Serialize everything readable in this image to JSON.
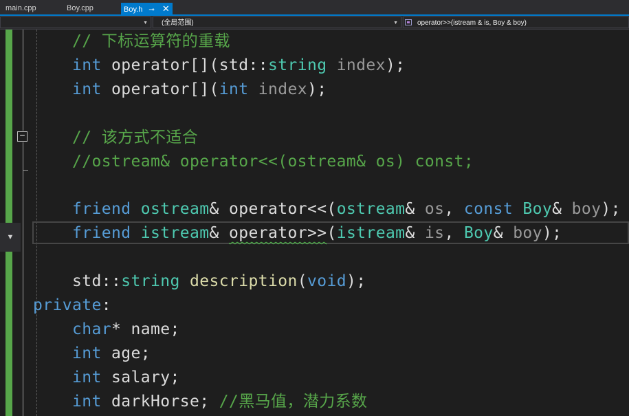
{
  "tabs": [
    {
      "label": "main.cpp",
      "active": false
    },
    {
      "label": "Boy.cpp",
      "active": false
    },
    {
      "label": "Boy.h",
      "active": true,
      "pin_icon": "pin-icon",
      "close_icon": "close-icon"
    }
  ],
  "navbar": {
    "project_combo": "",
    "scope_combo": "(全局范围)",
    "member_combo": "operator>>(istream & is, Boy & boy)",
    "member_icon": "method-icon"
  },
  "colors": {
    "keyword": "#569cd6",
    "type": "#4ec9b0",
    "comment": "#57a64a",
    "parameter": "#9a9a9a",
    "function": "#dcdcaa",
    "text": "#dcdcdc",
    "background": "#1e1e1e",
    "accent": "#007acc"
  },
  "editor": {
    "fold_icon": "collapse-minus-icon",
    "lines": [
      {
        "tokens": [
          {
            "t": "    "
          },
          {
            "t": "// 下标运算符的重载",
            "c": "cm"
          }
        ]
      },
      {
        "tokens": [
          {
            "t": "    "
          },
          {
            "t": "int",
            "c": "kw"
          },
          {
            "t": " operator[](std::"
          },
          {
            "t": "string",
            "c": "ty"
          },
          {
            "t": " "
          },
          {
            "t": "index",
            "c": "pm"
          },
          {
            "t": ");"
          }
        ]
      },
      {
        "tokens": [
          {
            "t": "    "
          },
          {
            "t": "int",
            "c": "kw"
          },
          {
            "t": " operator[]("
          },
          {
            "t": "int",
            "c": "kw"
          },
          {
            "t": " "
          },
          {
            "t": "index",
            "c": "pm"
          },
          {
            "t": ");"
          }
        ]
      },
      {
        "tokens": []
      },
      {
        "tokens": [
          {
            "t": "    "
          },
          {
            "t": "// 该方式不适合",
            "c": "cm"
          }
        ]
      },
      {
        "tokens": [
          {
            "t": "    "
          },
          {
            "t": "//ostream& operator<<(ostream& os) const;",
            "c": "cm"
          }
        ]
      },
      {
        "tokens": []
      },
      {
        "tokens": [
          {
            "t": "    "
          },
          {
            "t": "friend",
            "c": "kw"
          },
          {
            "t": " "
          },
          {
            "t": "ostream",
            "c": "ty"
          },
          {
            "t": "& operator<<("
          },
          {
            "t": "ostream",
            "c": "ty"
          },
          {
            "t": "& "
          },
          {
            "t": "os",
            "c": "pm"
          },
          {
            "t": ", "
          },
          {
            "t": "const",
            "c": "kw"
          },
          {
            "t": " "
          },
          {
            "t": "Boy",
            "c": "ty"
          },
          {
            "t": "& "
          },
          {
            "t": "boy",
            "c": "pm"
          },
          {
            "t": ");"
          }
        ]
      },
      {
        "tokens": [
          {
            "t": "    "
          },
          {
            "t": "friend",
            "c": "kw"
          },
          {
            "t": " "
          },
          {
            "t": "istream",
            "c": "ty"
          },
          {
            "t": "& "
          },
          {
            "t": "operator>>",
            "c": "squiggle"
          },
          {
            "t": "("
          },
          {
            "t": "istream",
            "c": "ty"
          },
          {
            "t": "& "
          },
          {
            "t": "is",
            "c": "pm"
          },
          {
            "t": ", "
          },
          {
            "t": "Boy",
            "c": "ty"
          },
          {
            "t": "& "
          },
          {
            "t": "boy",
            "c": "pm"
          },
          {
            "t": ");"
          }
        ]
      },
      {
        "tokens": []
      },
      {
        "tokens": [
          {
            "t": "    std::"
          },
          {
            "t": "string",
            "c": "ty"
          },
          {
            "t": " "
          },
          {
            "t": "description",
            "c": "fn"
          },
          {
            "t": "("
          },
          {
            "t": "void",
            "c": "kw"
          },
          {
            "t": ");"
          }
        ]
      },
      {
        "tokens": [
          {
            "t": "private",
            "c": "kw"
          },
          {
            "t": ":"
          }
        ]
      },
      {
        "tokens": [
          {
            "t": "    "
          },
          {
            "t": "char",
            "c": "kw"
          },
          {
            "t": "* name;"
          }
        ]
      },
      {
        "tokens": [
          {
            "t": "    "
          },
          {
            "t": "int",
            "c": "kw"
          },
          {
            "t": " age;"
          }
        ]
      },
      {
        "tokens": [
          {
            "t": "    "
          },
          {
            "t": "int",
            "c": "kw"
          },
          {
            "t": " salary;"
          }
        ]
      },
      {
        "tokens": [
          {
            "t": "    "
          },
          {
            "t": "int",
            "c": "kw"
          },
          {
            "t": " darkHorse; "
          },
          {
            "t": "//黑马值，潜力系数",
            "c": "cm"
          }
        ]
      }
    ]
  }
}
